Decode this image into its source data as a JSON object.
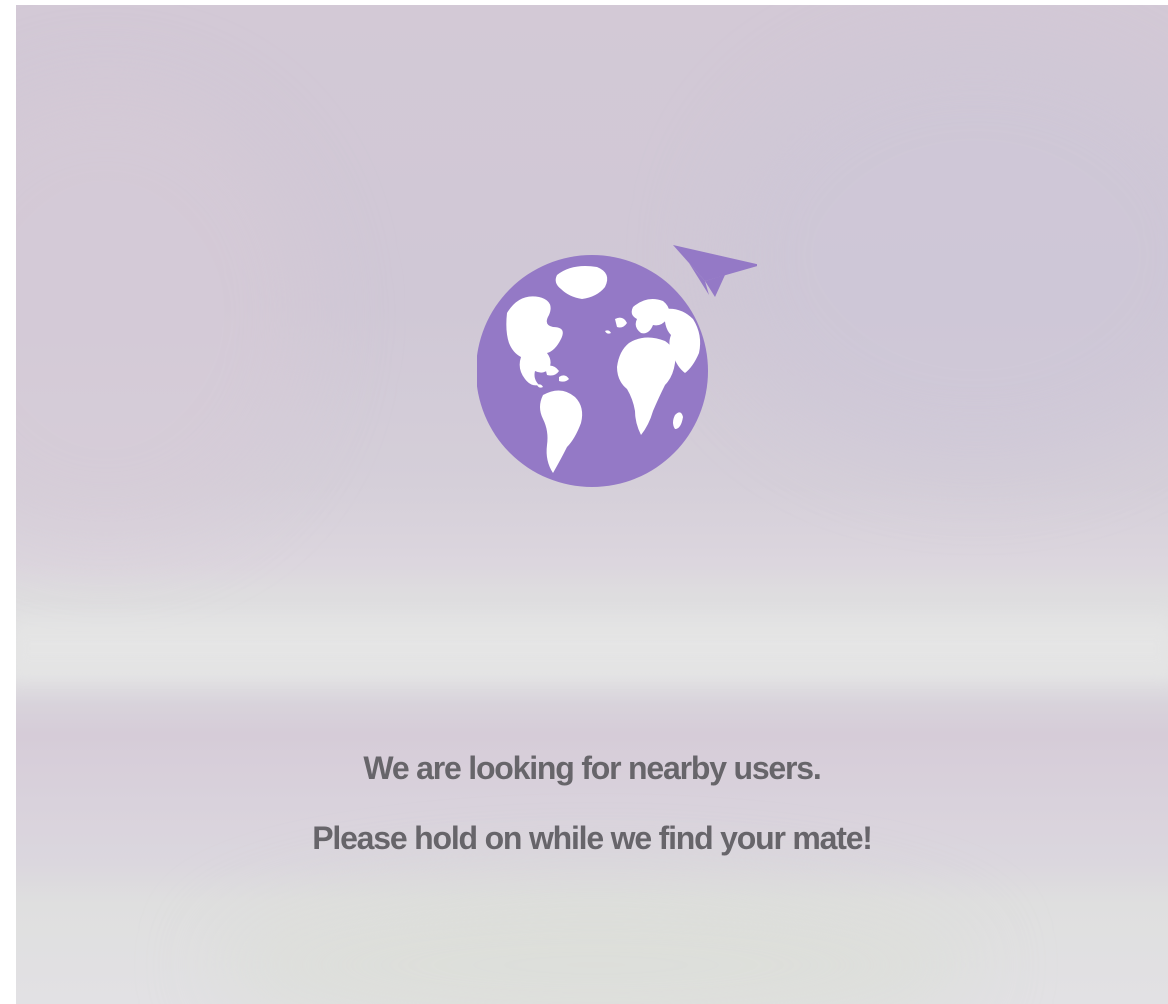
{
  "screen": {
    "icons": {
      "globe": "globe-icon",
      "plane": "paper-plane-icon"
    },
    "colors": {
      "accent": "#9479c6",
      "continents": "#ffffff",
      "text": "#67656a"
    },
    "message": {
      "line1": "We are looking for nearby users.",
      "line2": "Please hold on while we find your mate!"
    }
  }
}
